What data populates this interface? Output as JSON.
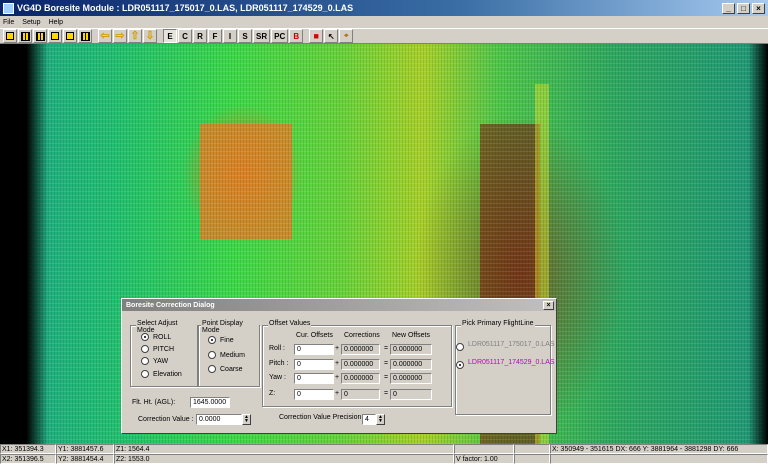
{
  "window": {
    "title": "VG4D Boresite Module : LDR051117_175017_0.LAS, LDR051117_174529_0.LAS",
    "btn_min": "_",
    "btn_max": "□",
    "btn_close": "×"
  },
  "menu": [
    "File",
    "Setup",
    "Help"
  ],
  "toolbar": {
    "text_buttons": [
      "E",
      "C",
      "R",
      "F",
      "I",
      "S",
      "SR",
      "PC",
      "B"
    ]
  },
  "dialog": {
    "title": "Boresite Correction Dialog",
    "close": "×",
    "adjust_mode": {
      "label": "Select Adjust Mode",
      "options": [
        "ROLL",
        "PITCH",
        "YAW",
        "Elevation"
      ],
      "selected": "ROLL"
    },
    "display_mode": {
      "label": "Point Display Mode",
      "options": [
        "Fine",
        "Medium",
        "Coarse"
      ],
      "selected": "Fine"
    },
    "offsets": {
      "label": "Offset Values",
      "headers": [
        "Cur. Offsets",
        "Corrections",
        "New Offsets"
      ],
      "rows": [
        {
          "label": "Roll :",
          "cur": "0",
          "op": "+",
          "corr": "0.000000",
          "eq": "=",
          "new": "0.000000"
        },
        {
          "label": "Pitch :",
          "cur": "0",
          "op": "+",
          "corr": "0.000000",
          "eq": "=",
          "new": "0.000000"
        },
        {
          "label": "Yaw :",
          "cur": "0",
          "op": "+",
          "corr": "0.000000",
          "eq": "=",
          "new": "0.000000"
        },
        {
          "label": "Z:",
          "cur": "0",
          "op": "+",
          "corr": "0",
          "eq": "=",
          "new": "0"
        }
      ]
    },
    "flightline": {
      "label": "Pick Primary FlightLine",
      "options": [
        "LDR051117_175017_0.LAS",
        "LDR051117_174529_0.LAS"
      ],
      "selected": "LDR051117_174529_0.LAS"
    },
    "flt_ht": {
      "label": "Flt. Ht. (AGL):",
      "value": "1645.0000"
    },
    "correction_value": {
      "label": "Correction Value :",
      "value": "0.0000"
    },
    "precision": {
      "label": "Correction Value Precision:",
      "value": "4"
    }
  },
  "status": {
    "row1": [
      "X1: 351394.3",
      "Y1: 3881457.6",
      "Z1: 1564.4",
      "",
      "",
      "X: 350949 - 351615 DX: 666  Y: 3881964 - 3881298 DY: 666"
    ],
    "row2": [
      "X2: 351396.5",
      "Y2: 3881454.4",
      "Z2: 1553.0",
      "V factor: 1.00",
      "",
      ""
    ]
  }
}
